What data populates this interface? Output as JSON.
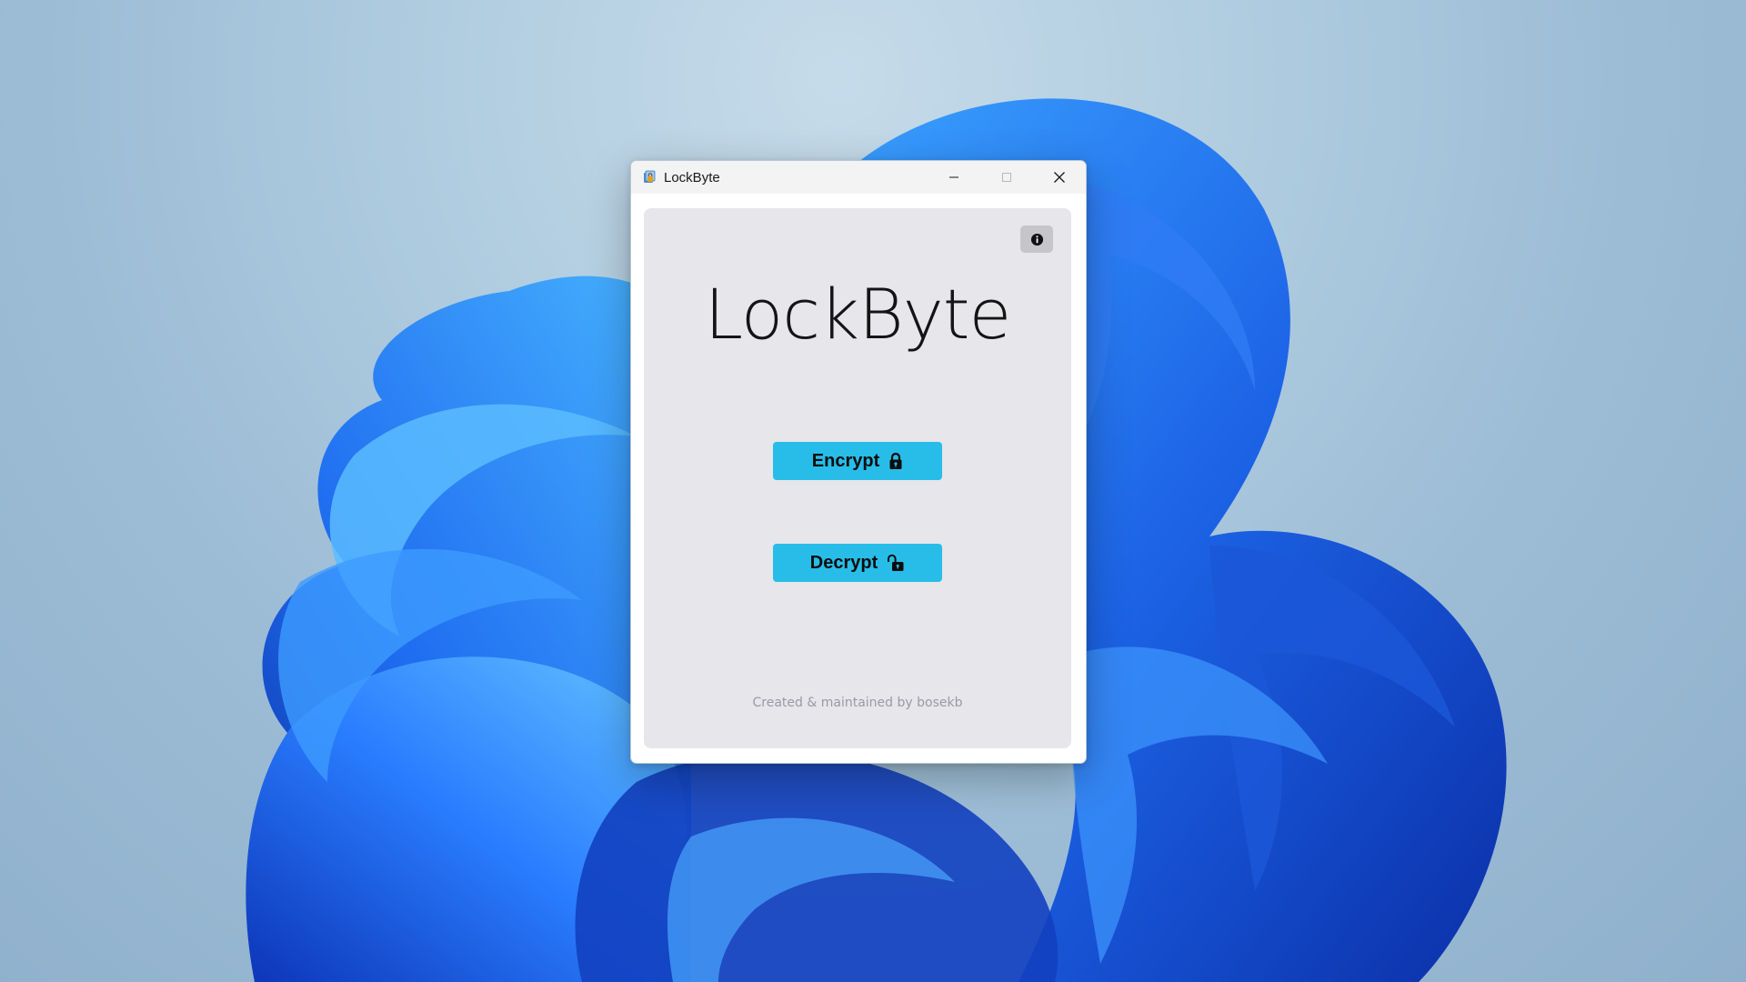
{
  "window": {
    "title": "LockByte"
  },
  "app": {
    "title": "LockByte",
    "encrypt_label": "Encrypt",
    "decrypt_label": "Decrypt",
    "footer": "Created & maintained by bosekb"
  },
  "icons": {
    "app": "lockbyte-app-icon",
    "info": "info-icon",
    "encrypt": "lock-closed-icon",
    "decrypt": "lock-open-icon",
    "minimize": "minimize-icon",
    "maximize": "maximize-icon",
    "close": "close-icon"
  },
  "colors": {
    "accent": "#28bde9",
    "panel": "#e7e6eb",
    "info_button": "#c6c5ca",
    "wallpaper_bloom": "#1a5fe0"
  }
}
